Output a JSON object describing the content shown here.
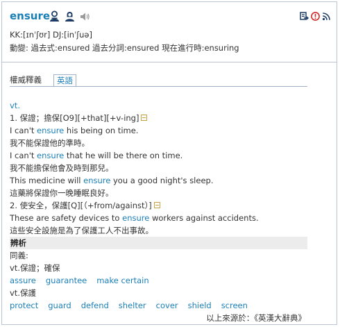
{
  "entry": {
    "word": "ensure",
    "pronunciation": "KK:[ɪnˈʃʊr] DJ:[inˈʃuə]",
    "forms": "動變: 過去式:ensured  過去分詞:ensured  現在進行時:ensuring"
  },
  "icons": [
    "us-speaker-icon",
    "uk-speaker-icon",
    "sound-icon",
    "export-icon",
    "info-icon",
    "rss-icon"
  ],
  "colors": {
    "accent": "#1b7fb7",
    "border": "#b9c4d6",
    "section_bg": "#ececec"
  },
  "tabs": [
    {
      "label": "權威釋義",
      "active": false
    },
    {
      "label": "英語",
      "active": true
    }
  ],
  "definition": {
    "pos": "vt.",
    "senses": [
      {
        "heading": "1. 保證；擔保[O9][+that][+v-ing]",
        "examples": [
          {
            "en_before": "I can't ",
            "keyword": "ensure",
            "en_after": " his being on time.",
            "zh": "我不能保證他的準時。"
          },
          {
            "en_before": "I can't ",
            "keyword": "ensure",
            "en_after": " that he will be there on time.",
            "zh": "我不能擔保他會及時到那兒。"
          },
          {
            "en_before": "This medicine will ",
            "keyword": "ensure",
            "en_after": " you a good night's sleep.",
            "zh": "這藥將保證你一晚睡眠良好。"
          }
        ]
      },
      {
        "heading": "2. 使安全，保護[Q][（+from/against）]",
        "examples": [
          {
            "en_before": "These are safety devices to ",
            "keyword": "ensure",
            "en_after": " workers against accidents.",
            "zh": "這些安全設施是為了保護工人不出事故。"
          }
        ]
      }
    ]
  },
  "analysis": {
    "title": "辨析",
    "synonyms_label": "同義:",
    "groups": [
      {
        "sense": "vt.保證；確保",
        "words": [
          "assure",
          "guarantee",
          "make certain"
        ]
      },
      {
        "sense": "vt.保護",
        "words": [
          "protect",
          "guard",
          "defend",
          "shelter",
          "cover",
          "shield",
          "screen"
        ]
      }
    ]
  },
  "source": "以上來源於：《英漢大辭典》"
}
